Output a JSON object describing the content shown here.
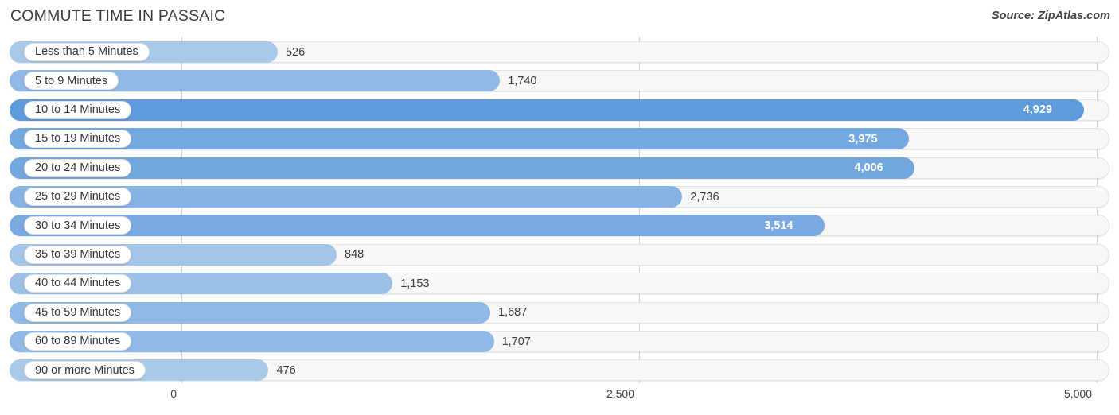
{
  "header": {
    "title": "COMMUTE TIME IN PASSAIC",
    "source": "Source: ZipAtlas.com"
  },
  "chart_data": {
    "type": "bar",
    "orientation": "horizontal",
    "title": "COMMUTE TIME IN PASSAIC",
    "subtitle": "",
    "xlabel": "",
    "ylabel": "",
    "xlim": [
      0,
      5000
    ],
    "grid": true,
    "legend": null,
    "source": "Source: ZipAtlas.com",
    "tick_labels": [
      "0",
      "2,500",
      "5,000"
    ],
    "ticks": [
      0,
      2500,
      5000
    ],
    "categories": [
      "Less than 5 Minutes",
      "5 to 9 Minutes",
      "10 to 14 Minutes",
      "15 to 19 Minutes",
      "20 to 24 Minutes",
      "25 to 29 Minutes",
      "30 to 34 Minutes",
      "35 to 39 Minutes",
      "40 to 44 Minutes",
      "45 to 59 Minutes",
      "60 to 89 Minutes",
      "90 or more Minutes"
    ],
    "values": [
      526,
      1740,
      4929,
      3975,
      4006,
      2736,
      3514,
      848,
      1153,
      1687,
      1707,
      476
    ],
    "value_labels": [
      "526",
      "1,740",
      "4,929",
      "3,975",
      "4,006",
      "2,736",
      "3,514",
      "848",
      "1,153",
      "1,687",
      "1,707",
      "476"
    ],
    "bar_colors": [
      "#a9c9ea",
      "#8fb8e4",
      "#5d9bdc",
      "#74a8e0",
      "#73a7e0",
      "#87b3e3",
      "#7aaae1",
      "#a3c5e9",
      "#9cc1e7",
      "#91b9e5",
      "#90b9e5",
      "#aacaea"
    ],
    "label_inside": [
      false,
      false,
      true,
      true,
      true,
      false,
      true,
      false,
      false,
      false,
      false,
      false
    ]
  },
  "colors": {
    "accent": "#5d9bdc",
    "track": "#f7f7f7",
    "gridline": "#d3d3d3",
    "text": "#3a3a42"
  }
}
